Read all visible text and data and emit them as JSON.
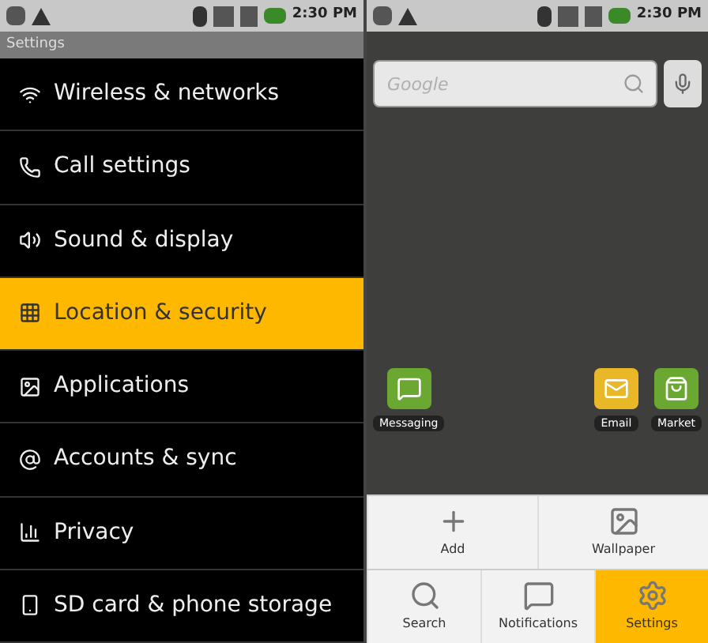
{
  "left": {
    "status_bar": {
      "time": "2:30 PM"
    },
    "title": "Settings",
    "items": [
      {
        "label": "Wireless & networks",
        "selected": false
      },
      {
        "label": "Call settings",
        "selected": false
      },
      {
        "label": "Sound & display",
        "selected": false
      },
      {
        "label": "Location & security",
        "selected": true
      },
      {
        "label": "Applications",
        "selected": false
      },
      {
        "label": "Accounts & sync",
        "selected": false
      },
      {
        "label": "Privacy",
        "selected": false
      },
      {
        "label": "SD card & phone storage",
        "selected": false
      }
    ]
  },
  "right": {
    "status_bar": {
      "time": "2:30 PM"
    },
    "search": {
      "placeholder": "Google"
    },
    "apps": [
      {
        "label": "Messaging",
        "kind": "messaging"
      },
      {
        "label": "Email",
        "kind": "email"
      },
      {
        "label": "Market",
        "kind": "market"
      }
    ],
    "menu": [
      [
        {
          "label": "Add",
          "selected": false
        },
        {
          "label": "Wallpaper",
          "selected": false
        }
      ],
      [
        {
          "label": "Search",
          "selected": false
        },
        {
          "label": "Notifications",
          "selected": false
        },
        {
          "label": "Settings",
          "selected": true
        }
      ]
    ]
  }
}
